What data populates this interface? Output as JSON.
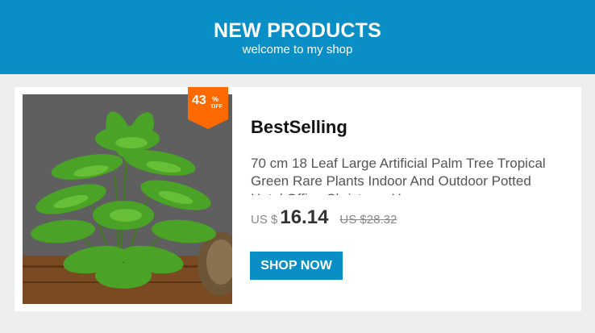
{
  "banner": {
    "title": "NEW PRODUCTS",
    "subtitle": "welcome to my shop"
  },
  "product": {
    "image_icon": "plant-photo",
    "discount": {
      "value": "43",
      "percent": "%",
      "off": "OFF",
      "color": "#ff6a00"
    },
    "headline": "BestSelling",
    "description": "70 cm 18 Leaf Large Artificial Palm Tree Tropical Green Rare Plants Indoor And Outdoor Potted Hotel Office Christmas Home",
    "currency": "US $",
    "price": "16.14",
    "original_price": "US $28.32",
    "button_label": "SHOP NOW"
  },
  "colors": {
    "accent": "#0a8ec6",
    "badge": "#ff6a00",
    "background": "#eeeeee"
  }
}
